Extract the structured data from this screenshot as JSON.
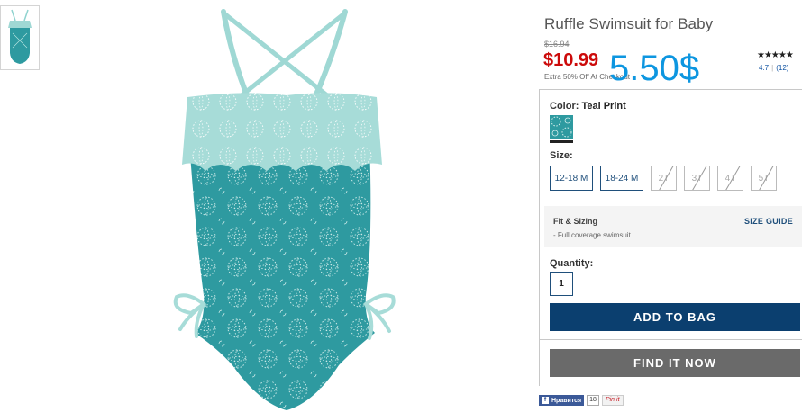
{
  "product": {
    "title": "Ruffle Swimsuit for Baby",
    "old_price": "$16.94",
    "sale_price": "$10.99",
    "promo_text": "Extra 50% Off At Checkout",
    "overlay_price": "5.50$"
  },
  "rating": {
    "stars": "★★★★★",
    "score": "4.7",
    "count": "(12)",
    "filled_stars": 5,
    "max_stars": 5
  },
  "color": {
    "label": "Color:",
    "value": "Teal Print",
    "swatch_color": "#2e9aa0"
  },
  "size": {
    "label": "Size:",
    "options": [
      {
        "label": "12-18 M",
        "available": true
      },
      {
        "label": "18-24 M",
        "available": true
      },
      {
        "label": "2T",
        "available": false
      },
      {
        "label": "3T",
        "available": false
      },
      {
        "label": "4T",
        "available": false
      },
      {
        "label": "5T",
        "available": false
      }
    ]
  },
  "fit": {
    "title": "Fit & Sizing",
    "description": "- Full coverage swimsuit.",
    "size_guide_label": "SIZE GUIDE"
  },
  "quantity": {
    "label": "Quantity:",
    "value": "1"
  },
  "actions": {
    "add_to_bag": "ADD TO BAG",
    "find_it_now": "FIND IT NOW"
  },
  "social": {
    "facebook_label": "Нравится",
    "facebook_count": "18",
    "pinterest_label": "Pin it"
  },
  "colors": {
    "sale_red": "#cc0a0a",
    "navy": "#0b3f6f",
    "gray_button": "#6a6a6a",
    "overlay_blue": "#0d96e0",
    "teal": "#2e9aa0",
    "light_teal": "#a7dcd8"
  }
}
